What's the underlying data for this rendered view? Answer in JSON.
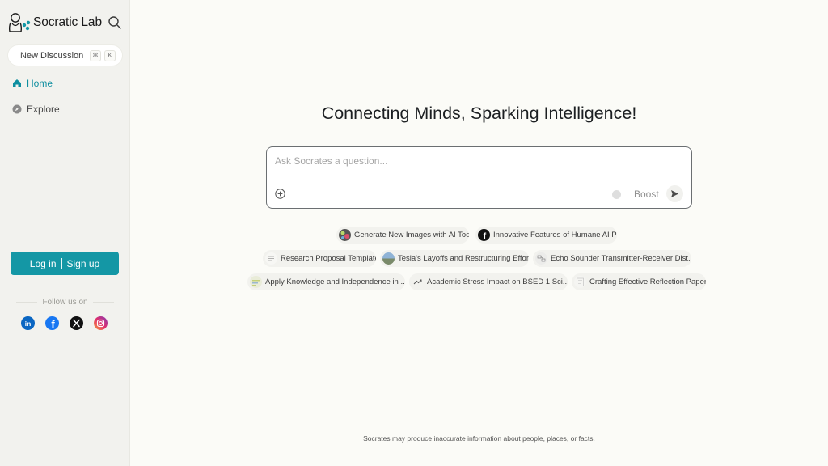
{
  "app": {
    "name": "Socratic Lab",
    "accent_color": "#1497a5"
  },
  "sidebar": {
    "new_discussion": {
      "label": "New Discussion",
      "shortcut_keys": [
        "⌘",
        "K"
      ]
    },
    "nav": [
      {
        "label": "Home",
        "icon": "home-icon",
        "active": true
      },
      {
        "label": "Explore",
        "icon": "compass-icon",
        "active": false
      }
    ],
    "auth": {
      "login_label": "Log in",
      "signup_label": "Sign up"
    },
    "follow_label": "Follow us on",
    "socials": [
      "linkedin-icon",
      "facebook-icon",
      "x-icon",
      "instagram-icon"
    ]
  },
  "main": {
    "headline": "Connecting Minds, Sparking Intelligence!",
    "ask": {
      "placeholder": "Ask Socrates a question...",
      "value": "",
      "boost_label": "Boost"
    },
    "suggestions": [
      {
        "label": "Generate New Images with AI Tools",
        "icon": "image-thumb"
      },
      {
        "label": "Innovative Features of Humane AI Pin",
        "icon": "facebook-thumb"
      },
      {
        "label": "Research Proposal Template",
        "icon": "list-thumb"
      },
      {
        "label": "Tesla's Layoffs and Restructuring Efforts",
        "icon": "photo-thumb"
      },
      {
        "label": "Echo Sounder Transmitter-Receiver Dist...",
        "icon": "diagram-thumb"
      },
      {
        "label": "Apply Knowledge and Independence in ...",
        "icon": "chart-thumb"
      },
      {
        "label": "Academic Stress Impact on BSED 1 Sci...",
        "icon": "trend-thumb"
      },
      {
        "label": "Crafting Effective Reflection Papers",
        "icon": "doc-thumb"
      }
    ],
    "disclaimer": "Socrates may produce inaccurate information about people, places, or facts."
  }
}
